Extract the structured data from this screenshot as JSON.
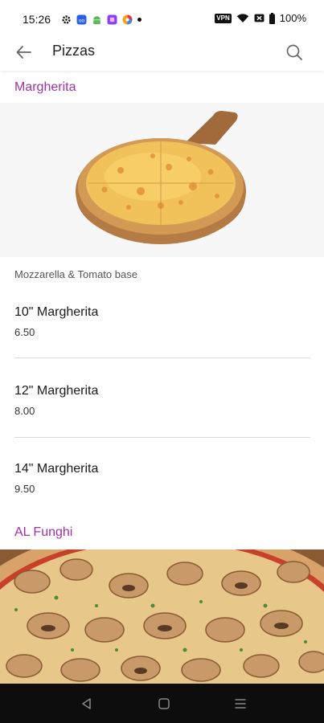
{
  "status_bar": {
    "time": "15:26",
    "vpn": "VPN",
    "battery": "100%"
  },
  "app_bar": {
    "title": "Pizzas"
  },
  "sections": [
    {
      "title": "Margherita",
      "description": "Mozzarella & Tomato base",
      "items": [
        {
          "name": "10\" Margherita",
          "price": "6.50"
        },
        {
          "name": "12\" Margherita",
          "price": "8.00"
        },
        {
          "name": "14\" Margherita",
          "price": "9.50"
        }
      ]
    },
    {
      "title": "AL Funghi"
    }
  ],
  "colors": {
    "accent": "#a030a8",
    "nav_bar": "#0d0d0d",
    "divider": "#d9d9d9"
  }
}
